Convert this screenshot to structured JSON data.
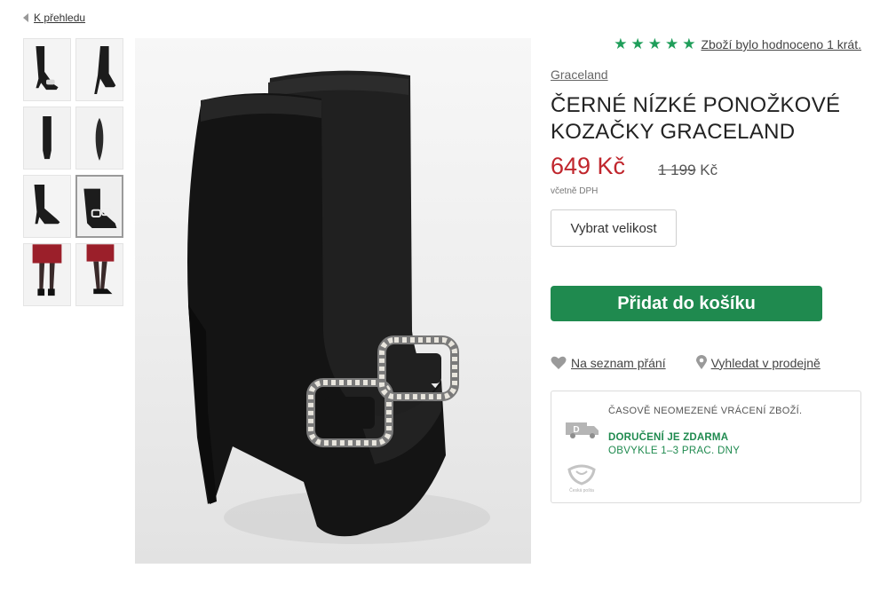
{
  "nav": {
    "back_label": "K přehledu"
  },
  "gallery": {
    "thumbnails": [
      "boot-pair-side",
      "boot-side-heel",
      "boot-front",
      "boot-sole",
      "boot-angle",
      "boot-buckle-closeup",
      "model-legs-front",
      "model-legs-side"
    ],
    "active_index": 5,
    "hero_alt": "black-sock-boots-with-pearl-buckle"
  },
  "rating": {
    "stars": 5,
    "text": "Zboží bylo hodnoceno 1 krát.",
    "color": "#1f9e5a"
  },
  "product": {
    "brand": "Graceland",
    "title": "ČERNÉ NÍZKÉ PONOŽKOVÉ KOZAČKY GRACELAND",
    "price": "649 Kč",
    "old_price_number": "1 199",
    "old_price_currency": " Kč",
    "vat_note": "včetně DPH",
    "price_color": "#c0262d"
  },
  "actions": {
    "size_label": "Vybrat velikost",
    "cart_label": "Přidat do košíku",
    "cart_color": "#1f8a4f",
    "wishlist_label": "Na seznam přání",
    "store_label": "Vyhledat v prodejně"
  },
  "shipping": {
    "returns": "ČASOVĚ NEOMEZENÉ VRÁCENÍ ZBOŽÍ.",
    "delivery": "DORUČENÍ JE ZDARMA",
    "delivery_time": "OBVYKLE 1–3 PRAC. DNY",
    "truck_letter": "D",
    "post_logo_text": "Česká pošta"
  }
}
